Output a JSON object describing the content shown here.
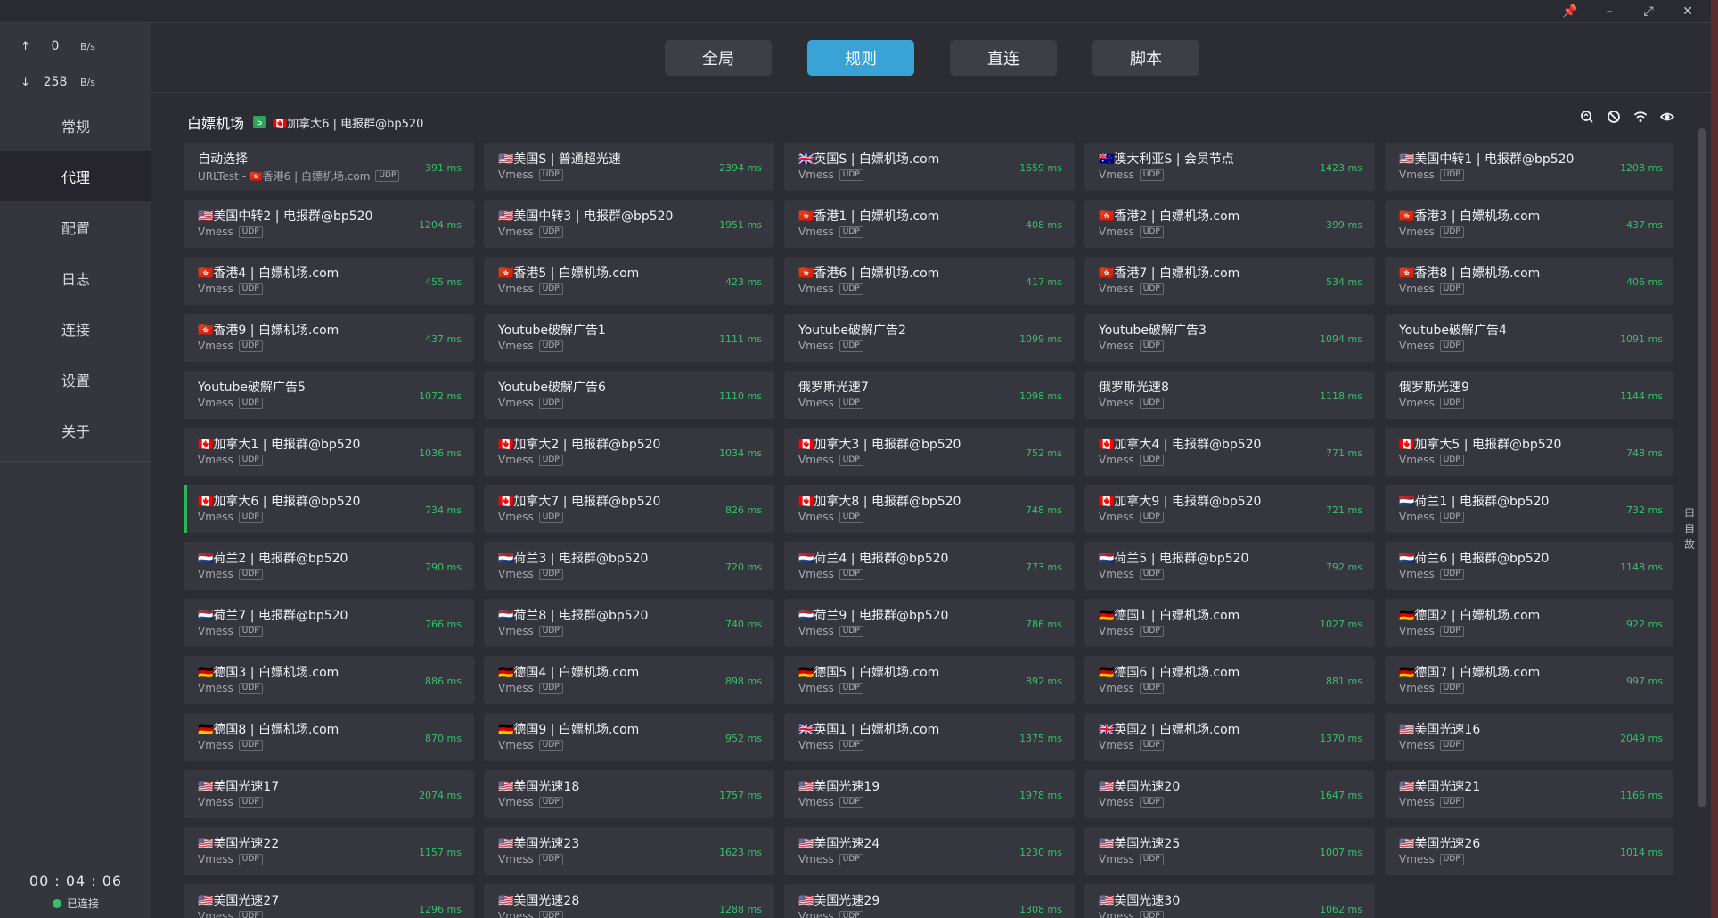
{
  "window": {
    "pin": "📌",
    "minimize": "–",
    "maximize": "⤢",
    "close": "✕"
  },
  "traffic": {
    "up_arrow": "↑",
    "up_value": "0",
    "up_unit": "B/s",
    "down_arrow": "↓",
    "down_value": "258",
    "down_unit": "B/s"
  },
  "nav": [
    "常规",
    "代理",
    "配置",
    "日志",
    "连接",
    "设置",
    "关于"
  ],
  "nav_active": 1,
  "timer": "00 : 04 : 06",
  "status": "已连接",
  "modes": [
    "全局",
    "规则",
    "直连",
    "脚本"
  ],
  "mode_active": 1,
  "group": {
    "title": "白嫖机场",
    "badge": "S",
    "current": "🇨🇦加拿大6 | 电报群@bp520"
  },
  "tool_icons": [
    "speed-test-icon",
    "hide-unavailable-icon",
    "wifi-icon",
    "eye-icon"
  ],
  "side_label": [
    "白",
    "自",
    "故"
  ],
  "colors": {
    "accent": "#3aa3d6",
    "delay_green": "#35c06a",
    "selected_bar": "#2ab55a",
    "card_bg": "#36363e"
  },
  "selected_proxy": 30,
  "proxies": [
    {
      "name": "自动选择",
      "sub": "URLTest - 🇭🇰香港6 | 白嫖机场.com",
      "udp": "UDP",
      "delay": "391 ms"
    },
    {
      "name": "🇺🇸美国S | 普通超光速",
      "sub": "Vmess",
      "udp": "UDP",
      "delay": "2394 ms"
    },
    {
      "name": "🇬🇧英国S | 白嫖机场.com",
      "sub": "Vmess",
      "udp": "UDP",
      "delay": "1659 ms"
    },
    {
      "name": "🇦🇺澳大利亚S | 会员节点",
      "sub": "Vmess",
      "udp": "UDP",
      "delay": "1423 ms"
    },
    {
      "name": "🇺🇸美国中转1 | 电报群@bp520",
      "sub": "Vmess",
      "udp": "UDP",
      "delay": "1208 ms"
    },
    {
      "name": "🇺🇸美国中转2 | 电报群@bp520",
      "sub": "Vmess",
      "udp": "UDP",
      "delay": "1204 ms"
    },
    {
      "name": "🇺🇸美国中转3 | 电报群@bp520",
      "sub": "Vmess",
      "udp": "UDP",
      "delay": "1951 ms"
    },
    {
      "name": "🇭🇰香港1 | 白嫖机场.com",
      "sub": "Vmess",
      "udp": "UDP",
      "delay": "408 ms"
    },
    {
      "name": "🇭🇰香港2 | 白嫖机场.com",
      "sub": "Vmess",
      "udp": "UDP",
      "delay": "399 ms"
    },
    {
      "name": "🇭🇰香港3 | 白嫖机场.com",
      "sub": "Vmess",
      "udp": "UDP",
      "delay": "437 ms"
    },
    {
      "name": "🇭🇰香港4 | 白嫖机场.com",
      "sub": "Vmess",
      "udp": "UDP",
      "delay": "455 ms"
    },
    {
      "name": "🇭🇰香港5 | 白嫖机场.com",
      "sub": "Vmess",
      "udp": "UDP",
      "delay": "423 ms"
    },
    {
      "name": "🇭🇰香港6 | 白嫖机场.com",
      "sub": "Vmess",
      "udp": "UDP",
      "delay": "417 ms"
    },
    {
      "name": "🇭🇰香港7 | 白嫖机场.com",
      "sub": "Vmess",
      "udp": "UDP",
      "delay": "534 ms"
    },
    {
      "name": "🇭🇰香港8 | 白嫖机场.com",
      "sub": "Vmess",
      "udp": "UDP",
      "delay": "406 ms"
    },
    {
      "name": "🇭🇰香港9 | 白嫖机场.com",
      "sub": "Vmess",
      "udp": "UDP",
      "delay": "437 ms"
    },
    {
      "name": "Youtube破解广告1",
      "sub": "Vmess",
      "udp": "UDP",
      "delay": "1111 ms"
    },
    {
      "name": "Youtube破解广告2",
      "sub": "Vmess",
      "udp": "UDP",
      "delay": "1099 ms"
    },
    {
      "name": "Youtube破解广告3",
      "sub": "Vmess",
      "udp": "UDP",
      "delay": "1094 ms"
    },
    {
      "name": "Youtube破解广告4",
      "sub": "Vmess",
      "udp": "UDP",
      "delay": "1091 ms"
    },
    {
      "name": "Youtube破解广告5",
      "sub": "Vmess",
      "udp": "UDP",
      "delay": "1072 ms"
    },
    {
      "name": "Youtube破解广告6",
      "sub": "Vmess",
      "udp": "UDP",
      "delay": "1110 ms"
    },
    {
      "name": "俄罗斯光速7",
      "sub": "Vmess",
      "udp": "UDP",
      "delay": "1098 ms"
    },
    {
      "name": "俄罗斯光速8",
      "sub": "Vmess",
      "udp": "UDP",
      "delay": "1118 ms"
    },
    {
      "name": "俄罗斯光速9",
      "sub": "Vmess",
      "udp": "UDP",
      "delay": "1144 ms"
    },
    {
      "name": "🇨🇦加拿大1 | 电报群@bp520",
      "sub": "Vmess",
      "udp": "UDP",
      "delay": "1036 ms"
    },
    {
      "name": "🇨🇦加拿大2 | 电报群@bp520",
      "sub": "Vmess",
      "udp": "UDP",
      "delay": "1034 ms"
    },
    {
      "name": "🇨🇦加拿大3 | 电报群@bp520",
      "sub": "Vmess",
      "udp": "UDP",
      "delay": "752 ms"
    },
    {
      "name": "🇨🇦加拿大4 | 电报群@bp520",
      "sub": "Vmess",
      "udp": "UDP",
      "delay": "771 ms"
    },
    {
      "name": "🇨🇦加拿大5 | 电报群@bp520",
      "sub": "Vmess",
      "udp": "UDP",
      "delay": "748 ms"
    },
    {
      "name": "🇨🇦加拿大6 | 电报群@bp520",
      "sub": "Vmess",
      "udp": "UDP",
      "delay": "734 ms"
    },
    {
      "name": "🇨🇦加拿大7 | 电报群@bp520",
      "sub": "Vmess",
      "udp": "UDP",
      "delay": "826 ms"
    },
    {
      "name": "🇨🇦加拿大8 | 电报群@bp520",
      "sub": "Vmess",
      "udp": "UDP",
      "delay": "748 ms"
    },
    {
      "name": "🇨🇦加拿大9 | 电报群@bp520",
      "sub": "Vmess",
      "udp": "UDP",
      "delay": "721 ms"
    },
    {
      "name": "🇳🇱荷兰1 | 电报群@bp520",
      "sub": "Vmess",
      "udp": "UDP",
      "delay": "732 ms"
    },
    {
      "name": "🇳🇱荷兰2 | 电报群@bp520",
      "sub": "Vmess",
      "udp": "UDP",
      "delay": "790 ms"
    },
    {
      "name": "🇳🇱荷兰3 | 电报群@bp520",
      "sub": "Vmess",
      "udp": "UDP",
      "delay": "720 ms"
    },
    {
      "name": "🇳🇱荷兰4 | 电报群@bp520",
      "sub": "Vmess",
      "udp": "UDP",
      "delay": "773 ms"
    },
    {
      "name": "🇳🇱荷兰5 | 电报群@bp520",
      "sub": "Vmess",
      "udp": "UDP",
      "delay": "792 ms"
    },
    {
      "name": "🇳🇱荷兰6 | 电报群@bp520",
      "sub": "Vmess",
      "udp": "UDP",
      "delay": "1148 ms"
    },
    {
      "name": "🇳🇱荷兰7 | 电报群@bp520",
      "sub": "Vmess",
      "udp": "UDP",
      "delay": "766 ms"
    },
    {
      "name": "🇳🇱荷兰8 | 电报群@bp520",
      "sub": "Vmess",
      "udp": "UDP",
      "delay": "740 ms"
    },
    {
      "name": "🇳🇱荷兰9 | 电报群@bp520",
      "sub": "Vmess",
      "udp": "UDP",
      "delay": "786 ms"
    },
    {
      "name": "🇩🇪德国1 | 白嫖机场.com",
      "sub": "Vmess",
      "udp": "UDP",
      "delay": "1027 ms"
    },
    {
      "name": "🇩🇪德国2 | 白嫖机场.com",
      "sub": "Vmess",
      "udp": "UDP",
      "delay": "922 ms"
    },
    {
      "name": "🇩🇪德国3 | 白嫖机场.com",
      "sub": "Vmess",
      "udp": "UDP",
      "delay": "886 ms"
    },
    {
      "name": "🇩🇪德国4 | 白嫖机场.com",
      "sub": "Vmess",
      "udp": "UDP",
      "delay": "898 ms"
    },
    {
      "name": "🇩🇪德国5 | 白嫖机场.com",
      "sub": "Vmess",
      "udp": "UDP",
      "delay": "892 ms"
    },
    {
      "name": "🇩🇪德国6 | 白嫖机场.com",
      "sub": "Vmess",
      "udp": "UDP",
      "delay": "881 ms"
    },
    {
      "name": "🇩🇪德国7 | 白嫖机场.com",
      "sub": "Vmess",
      "udp": "UDP",
      "delay": "997 ms"
    },
    {
      "name": "🇩🇪德国8 | 白嫖机场.com",
      "sub": "Vmess",
      "udp": "UDP",
      "delay": "870 ms"
    },
    {
      "name": "🇩🇪德国9 | 白嫖机场.com",
      "sub": "Vmess",
      "udp": "UDP",
      "delay": "952 ms"
    },
    {
      "name": "🇬🇧英国1 | 白嫖机场.com",
      "sub": "Vmess",
      "udp": "UDP",
      "delay": "1375 ms"
    },
    {
      "name": "🇬🇧英国2 | 白嫖机场.com",
      "sub": "Vmess",
      "udp": "UDP",
      "delay": "1370 ms"
    },
    {
      "name": "🇺🇸美国光速16",
      "sub": "Vmess",
      "udp": "UDP",
      "delay": "2049 ms"
    },
    {
      "name": "🇺🇸美国光速17",
      "sub": "Vmess",
      "udp": "UDP",
      "delay": "2074 ms"
    },
    {
      "name": "🇺🇸美国光速18",
      "sub": "Vmess",
      "udp": "UDP",
      "delay": "1757 ms"
    },
    {
      "name": "🇺🇸美国光速19",
      "sub": "Vmess",
      "udp": "UDP",
      "delay": "1978 ms"
    },
    {
      "name": "🇺🇸美国光速20",
      "sub": "Vmess",
      "udp": "UDP",
      "delay": "1647 ms"
    },
    {
      "name": "🇺🇸美国光速21",
      "sub": "Vmess",
      "udp": "UDP",
      "delay": "1166 ms"
    },
    {
      "name": "🇺🇸美国光速22",
      "sub": "Vmess",
      "udp": "UDP",
      "delay": "1157 ms"
    },
    {
      "name": "🇺🇸美国光速23",
      "sub": "Vmess",
      "udp": "UDP",
      "delay": "1623 ms"
    },
    {
      "name": "🇺🇸美国光速24",
      "sub": "Vmess",
      "udp": "UDP",
      "delay": "1230 ms"
    },
    {
      "name": "🇺🇸美国光速25",
      "sub": "Vmess",
      "udp": "UDP",
      "delay": "1007 ms"
    },
    {
      "name": "🇺🇸美国光速26",
      "sub": "Vmess",
      "udp": "UDP",
      "delay": "1014 ms"
    },
    {
      "name": "🇺🇸美国光速27",
      "sub": "Vmess",
      "udp": "UDP",
      "delay": "1296 ms"
    },
    {
      "name": "🇺🇸美国光速28",
      "sub": "Vmess",
      "udp": "UDP",
      "delay": "1288 ms"
    },
    {
      "name": "🇺🇸美国光速29",
      "sub": "Vmess",
      "udp": "UDP",
      "delay": "1308 ms"
    },
    {
      "name": "🇺🇸美国光速30",
      "sub": "Vmess",
      "udp": "UDP",
      "delay": "1062 ms"
    }
  ]
}
